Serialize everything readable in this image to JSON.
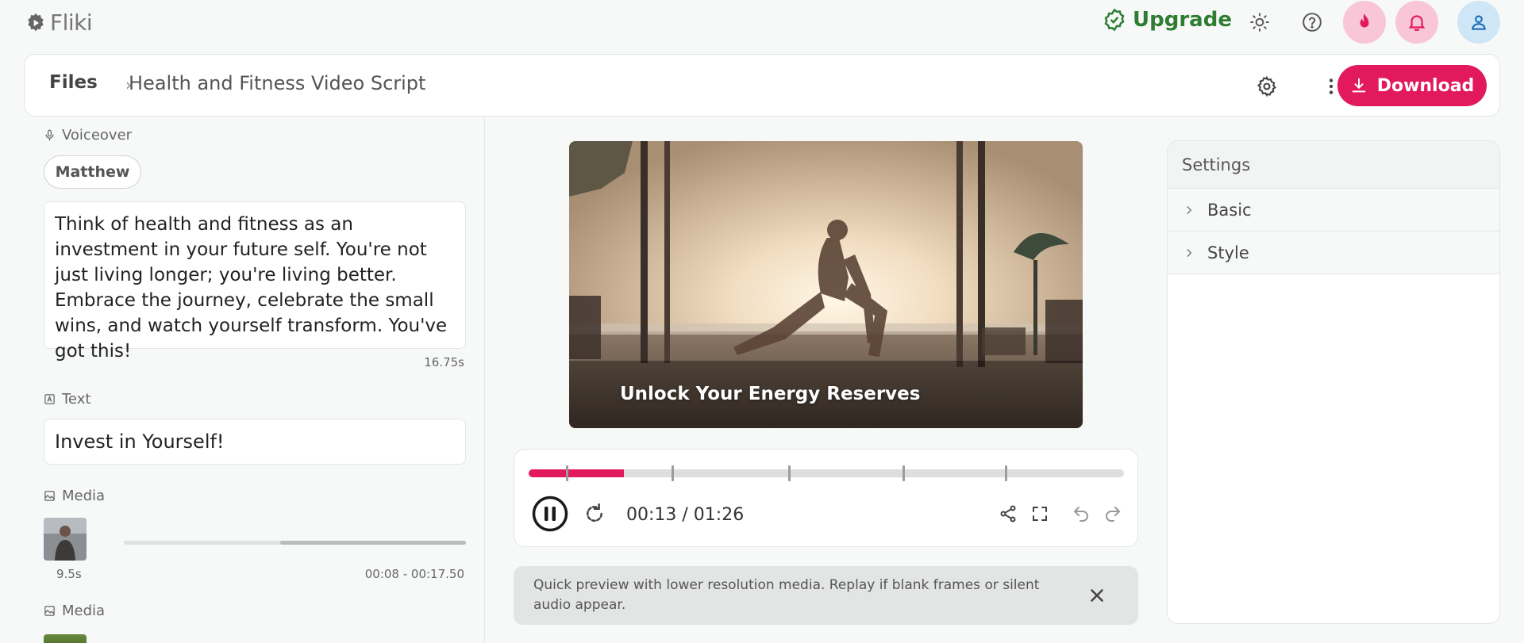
{
  "app": {
    "name": "Fliki"
  },
  "topbar": {
    "upgrade_label": "Upgrade",
    "upgrade_color": "#2e7d32",
    "icons": [
      "sun-icon",
      "help-icon",
      "flame-icon",
      "bell-icon",
      "user-icon"
    ]
  },
  "breadcrumb": {
    "root": "Files",
    "separator": "›",
    "current": "Health and Fitness Video Script"
  },
  "header": {
    "download_label": "Download",
    "accent": "#e21a5d"
  },
  "left_panel": {
    "voiceover": {
      "label": "Voiceover",
      "voice": "Matthew",
      "script": "Think of health and fitness as an investment in your future self. You're not just living longer; you're living better. Embrace the journey, celebrate the small wins, and watch yourself transform. You've got this!",
      "duration": "16.75s"
    },
    "text_block": {
      "label": "Text",
      "value": "Invest in Yourself!"
    },
    "media": [
      {
        "label": "Media",
        "duration": "9.5s",
        "range": "00:08 - 00:17.50"
      },
      {
        "label": "Media"
      }
    ]
  },
  "preview": {
    "caption": "Unlock Your Energy Reserves"
  },
  "player": {
    "time": "00:13 / 01:26",
    "progress_fraction": 0.16,
    "scene_markers": [
      0.062,
      0.24,
      0.436,
      0.628,
      0.8
    ]
  },
  "notice": {
    "text": "Quick preview with lower resolution media. Replay if blank frames or silent audio appear."
  },
  "settings": {
    "title": "Settings",
    "sections": [
      "Basic",
      "Style"
    ]
  }
}
